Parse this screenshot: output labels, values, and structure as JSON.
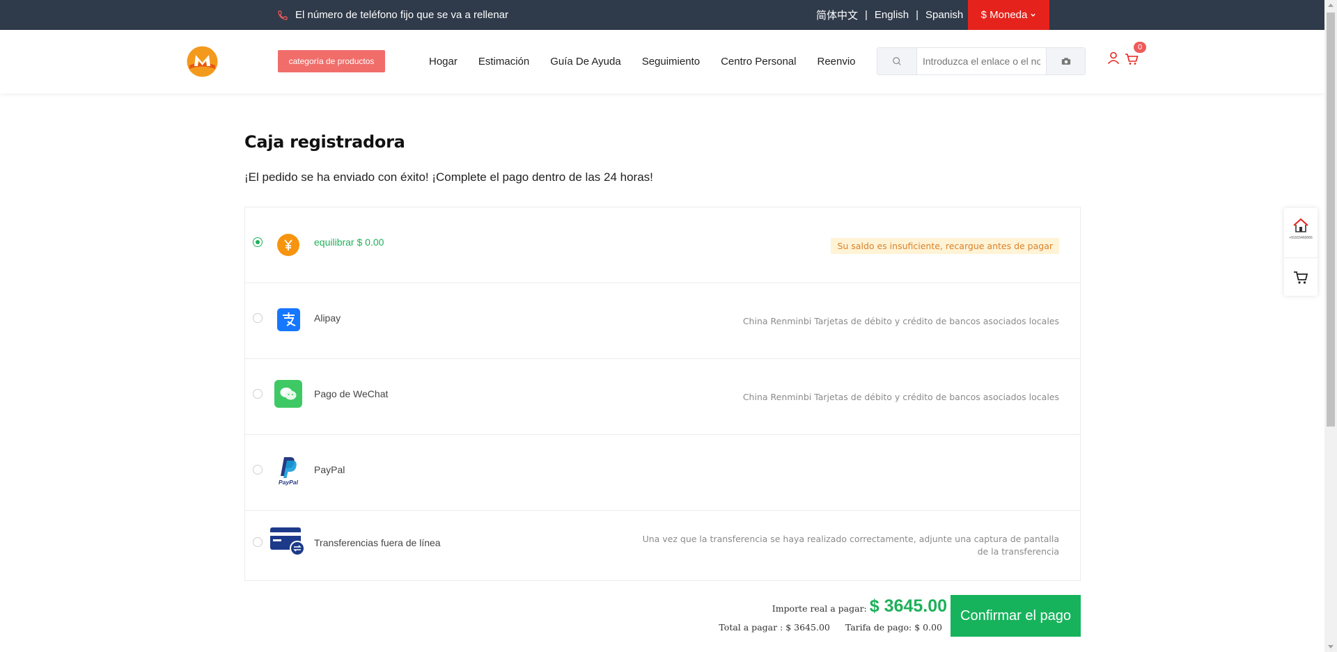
{
  "topbar": {
    "phone_text": "El número de teléfono fijo que se va a rellenar",
    "languages": [
      "简体中文",
      "English",
      "Spanish"
    ],
    "separator": "|",
    "currency_label": "$ Moneda"
  },
  "header": {
    "category_button": "categoría de productos",
    "nav": [
      "Hogar",
      "Estimación",
      "Guía De Ayuda",
      "Seguimiento",
      "Centro Personal",
      "Reenvio"
    ],
    "search_placeholder": "Introduzca el enlace o el no",
    "cart_count": "0"
  },
  "main": {
    "title": "Caja registradora",
    "subtitle": "¡El pedido se ha enviado con éxito! ¡Complete el pago dentro de las 24 horas!",
    "methods": [
      {
        "label": "equilibrar $ 0.00",
        "note": "Su saldo es insuficiente, recargue antes de pagar",
        "selected": true
      },
      {
        "label": "Alipay",
        "note": "China Renminbi Tarjetas de débito y crédito de bancos asociados locales",
        "selected": false
      },
      {
        "label": "Pago de WeChat",
        "note": "China Renminbi Tarjetas de débito y crédito de bancos asociados locales",
        "selected": false
      },
      {
        "label": "PayPal",
        "note": "",
        "selected": false
      },
      {
        "label": "Transferencias fuera de línea",
        "note": "Una vez que la transferencia se haya realizado correctamente, adjunte una captura de pantalla de la transferencia",
        "selected": false
      }
    ]
  },
  "payment": {
    "real_label": "Importe real a pagar:",
    "real_amount": "$ 3645.00",
    "total_label": "Total a pagar : $ 3645.00",
    "fee_label": "Tarifa de pago: $ 0.00",
    "confirm_button": "Confirmar el pago"
  },
  "float": {
    "home_text": "+91915460066"
  },
  "colors": {
    "topbar": "#2f3a4a",
    "currency": "#e5231c",
    "accent_green": "#1eb05a",
    "category_button": "#f06d6a"
  }
}
